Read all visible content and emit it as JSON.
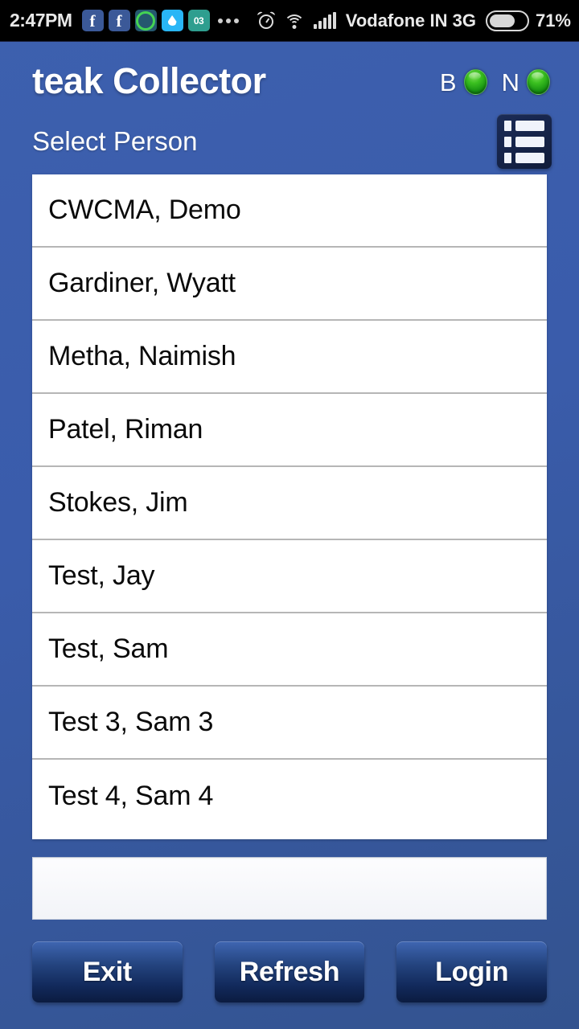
{
  "status_bar": {
    "time": "2:47PM",
    "notification_icons": [
      {
        "name": "facebook-icon",
        "label": ""
      },
      {
        "name": "facebook-icon",
        "label": ""
      },
      {
        "name": "whatsapp-icon",
        "label": ""
      },
      {
        "name": "water-drop-icon",
        "label": ""
      },
      {
        "name": "calendar-icon",
        "label": "03"
      }
    ],
    "overflow_dots": "...",
    "system_icons": [
      "alarm-icon",
      "wifi-icon",
      "signal-bars-icon"
    ],
    "carrier": "Vodafone IN 3G",
    "battery_percent": "71%",
    "battery_level": 71,
    "background_color": "#000000",
    "text_color": "#e9e9e9"
  },
  "app": {
    "title": "teak Collector",
    "background_color": "#3a5cab",
    "indicators": [
      {
        "label": "B",
        "state_color": "#27a818",
        "state": "on"
      },
      {
        "label": "N",
        "state_color": "#27a818",
        "state": "on"
      }
    ]
  },
  "select_section": {
    "label": "Select Person",
    "menu_icon": "list-menu-icon"
  },
  "person_list": {
    "items": [
      {
        "name": "CWCMA, Demo"
      },
      {
        "name": "Gardiner, Wyatt"
      },
      {
        "name": "Metha, Naimish"
      },
      {
        "name": "Patel, Riman"
      },
      {
        "name": "Stokes, Jim"
      },
      {
        "name": "Test, Jay"
      },
      {
        "name": "Test, Sam"
      },
      {
        "name": "Test 3, Sam 3"
      },
      {
        "name": "Test 4, Sam 4"
      }
    ]
  },
  "input_field": {
    "value": "",
    "placeholder": ""
  },
  "buttons": {
    "exit": "Exit",
    "refresh": "Refresh",
    "login": "Login"
  }
}
